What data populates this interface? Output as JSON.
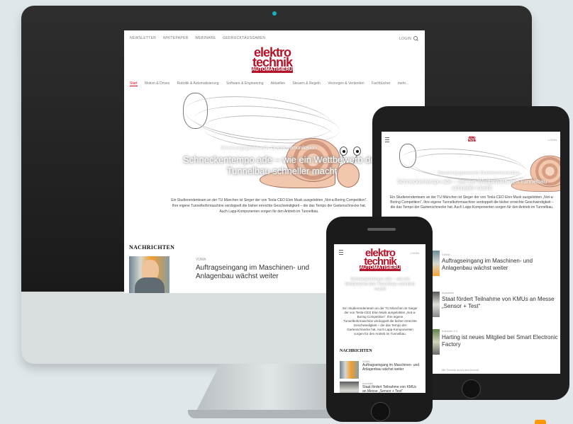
{
  "site": {
    "logo_line1": "elektro",
    "logo_line2": "technik",
    "logo_sub": "AUTOMATISIERUNG",
    "top_links": [
      "NEWSLETTER",
      "WHITEPAPER",
      "WEBINARE",
      "GEDRUCKTAUSGABEN"
    ],
    "login": "LOGIN",
    "main_nav": [
      "Start",
      "Motion & Drives",
      "Robotik & Automatisierung",
      "Software & Engineering",
      "Aktuelles",
      "Steuern & Regeln",
      "Versorgen & Verbinden",
      "Fachbücher",
      "mehr..."
    ]
  },
  "hero": {
    "kicker": "Steuerungsgesteuerte Drahtkommunikation",
    "title": "Schneckentempo ade – wie ein Wettbewerb den Tunnelbau schneller macht",
    "text": "Ein Studierendenteam an der TU München ist Sieger der von Tesla-CEO Elon Musk ausgelobten „Not-a-Boring Competition“. Ihre eigene Tunnelbohrmaschine verdoppelt die bisher erreichte Geschwindigkeit – die das Tempo der Gartenschnecke hat. Auch Lapp-Komponenten sorgen für den Antrieb im Tunnelbau."
  },
  "news": {
    "heading": "NACHRICHTEN",
    "items": [
      {
        "label": "VDMA",
        "title": "Auftragseingang im Maschinen- und Anlagenbau wächst weiter"
      },
      {
        "label": "Aussteller",
        "title": "Staat fördert Teilnahme von KMUs an Messe „Sensor + Test“"
      },
      {
        "label": "Industrie 4.0",
        "title": "Harting ist neues Mitglied bei Smart Electronic Factory"
      },
      {
        "label": "Mit Technik durch den Advent",
        "title": ""
      }
    ]
  },
  "colors": {
    "brand_red": "#b51327",
    "accent_red": "#e3000f",
    "background": "#dfe7eb"
  }
}
